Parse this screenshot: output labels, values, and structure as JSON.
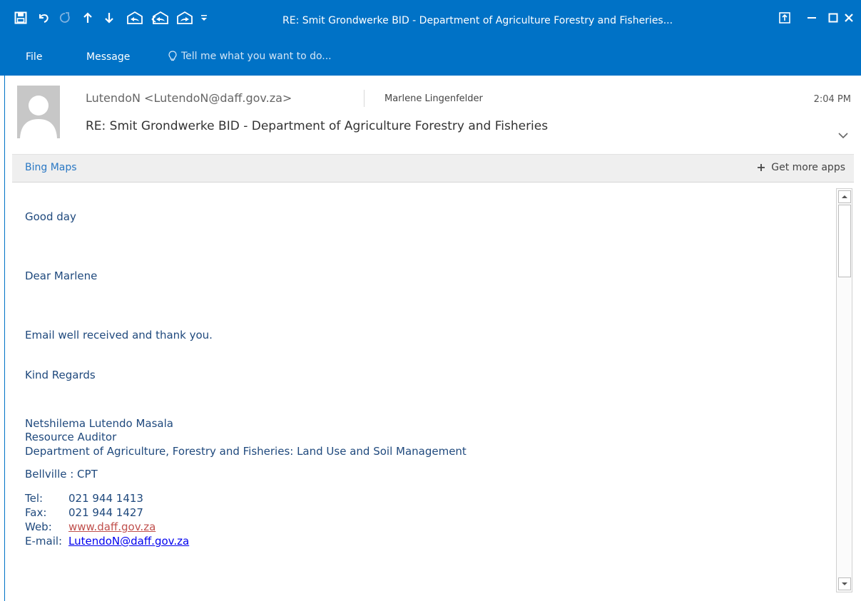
{
  "window": {
    "title": "RE: Smit Grondwerke BID - Department of Agriculture Forestry and Fisheries..."
  },
  "menu": {
    "file": "File",
    "message": "Message",
    "tell_me": "Tell me what you want to do..."
  },
  "message": {
    "sender": "LutendoN <LutendoN@daff.gov.za>",
    "recipient": "Marlene Lingenfelder",
    "time": "2:04 PM",
    "subject": "RE: Smit Grondwerke BID - Department of Agriculture Forestry and Fisheries"
  },
  "apps": {
    "bing_maps": "Bing Maps",
    "get_more": "Get more apps"
  },
  "body": {
    "greeting": "Good day",
    "salutation": "Dear Marlene",
    "text": "Email well received and thank you.",
    "closing": "Kind Regards",
    "signature": {
      "name": "Netshilema Lutendo Masala",
      "title": "Resource Auditor",
      "department": "Department of Agriculture, Forestry and Fisheries: Land Use and Soil Management",
      "location": "Bellville : CPT",
      "tel_label": "Tel:",
      "tel": "021 944 1413",
      "fax_label": "Fax:",
      "fax": "021 944 1427",
      "web_label": "Web:",
      "web": "www.daff.gov.za",
      "email_label": "E-mail:",
      "email": "LutendoN@daff.gov.za"
    }
  },
  "icons": {
    "quick_access": [
      "save-icon",
      "undo-icon",
      "redo-icon",
      "previous-item-icon",
      "next-item-icon",
      "reply-icon",
      "reply-all-icon",
      "forward-icon",
      "customize-toolbar-icon"
    ],
    "window_controls": [
      "ribbon-display-options-icon",
      "minimize-icon",
      "maximize-icon",
      "close-icon"
    ]
  },
  "colors": {
    "accent": "#0072c6",
    "body_text": "#1f497d",
    "web_link": "#c0504d",
    "email_link": "#0000ee"
  }
}
